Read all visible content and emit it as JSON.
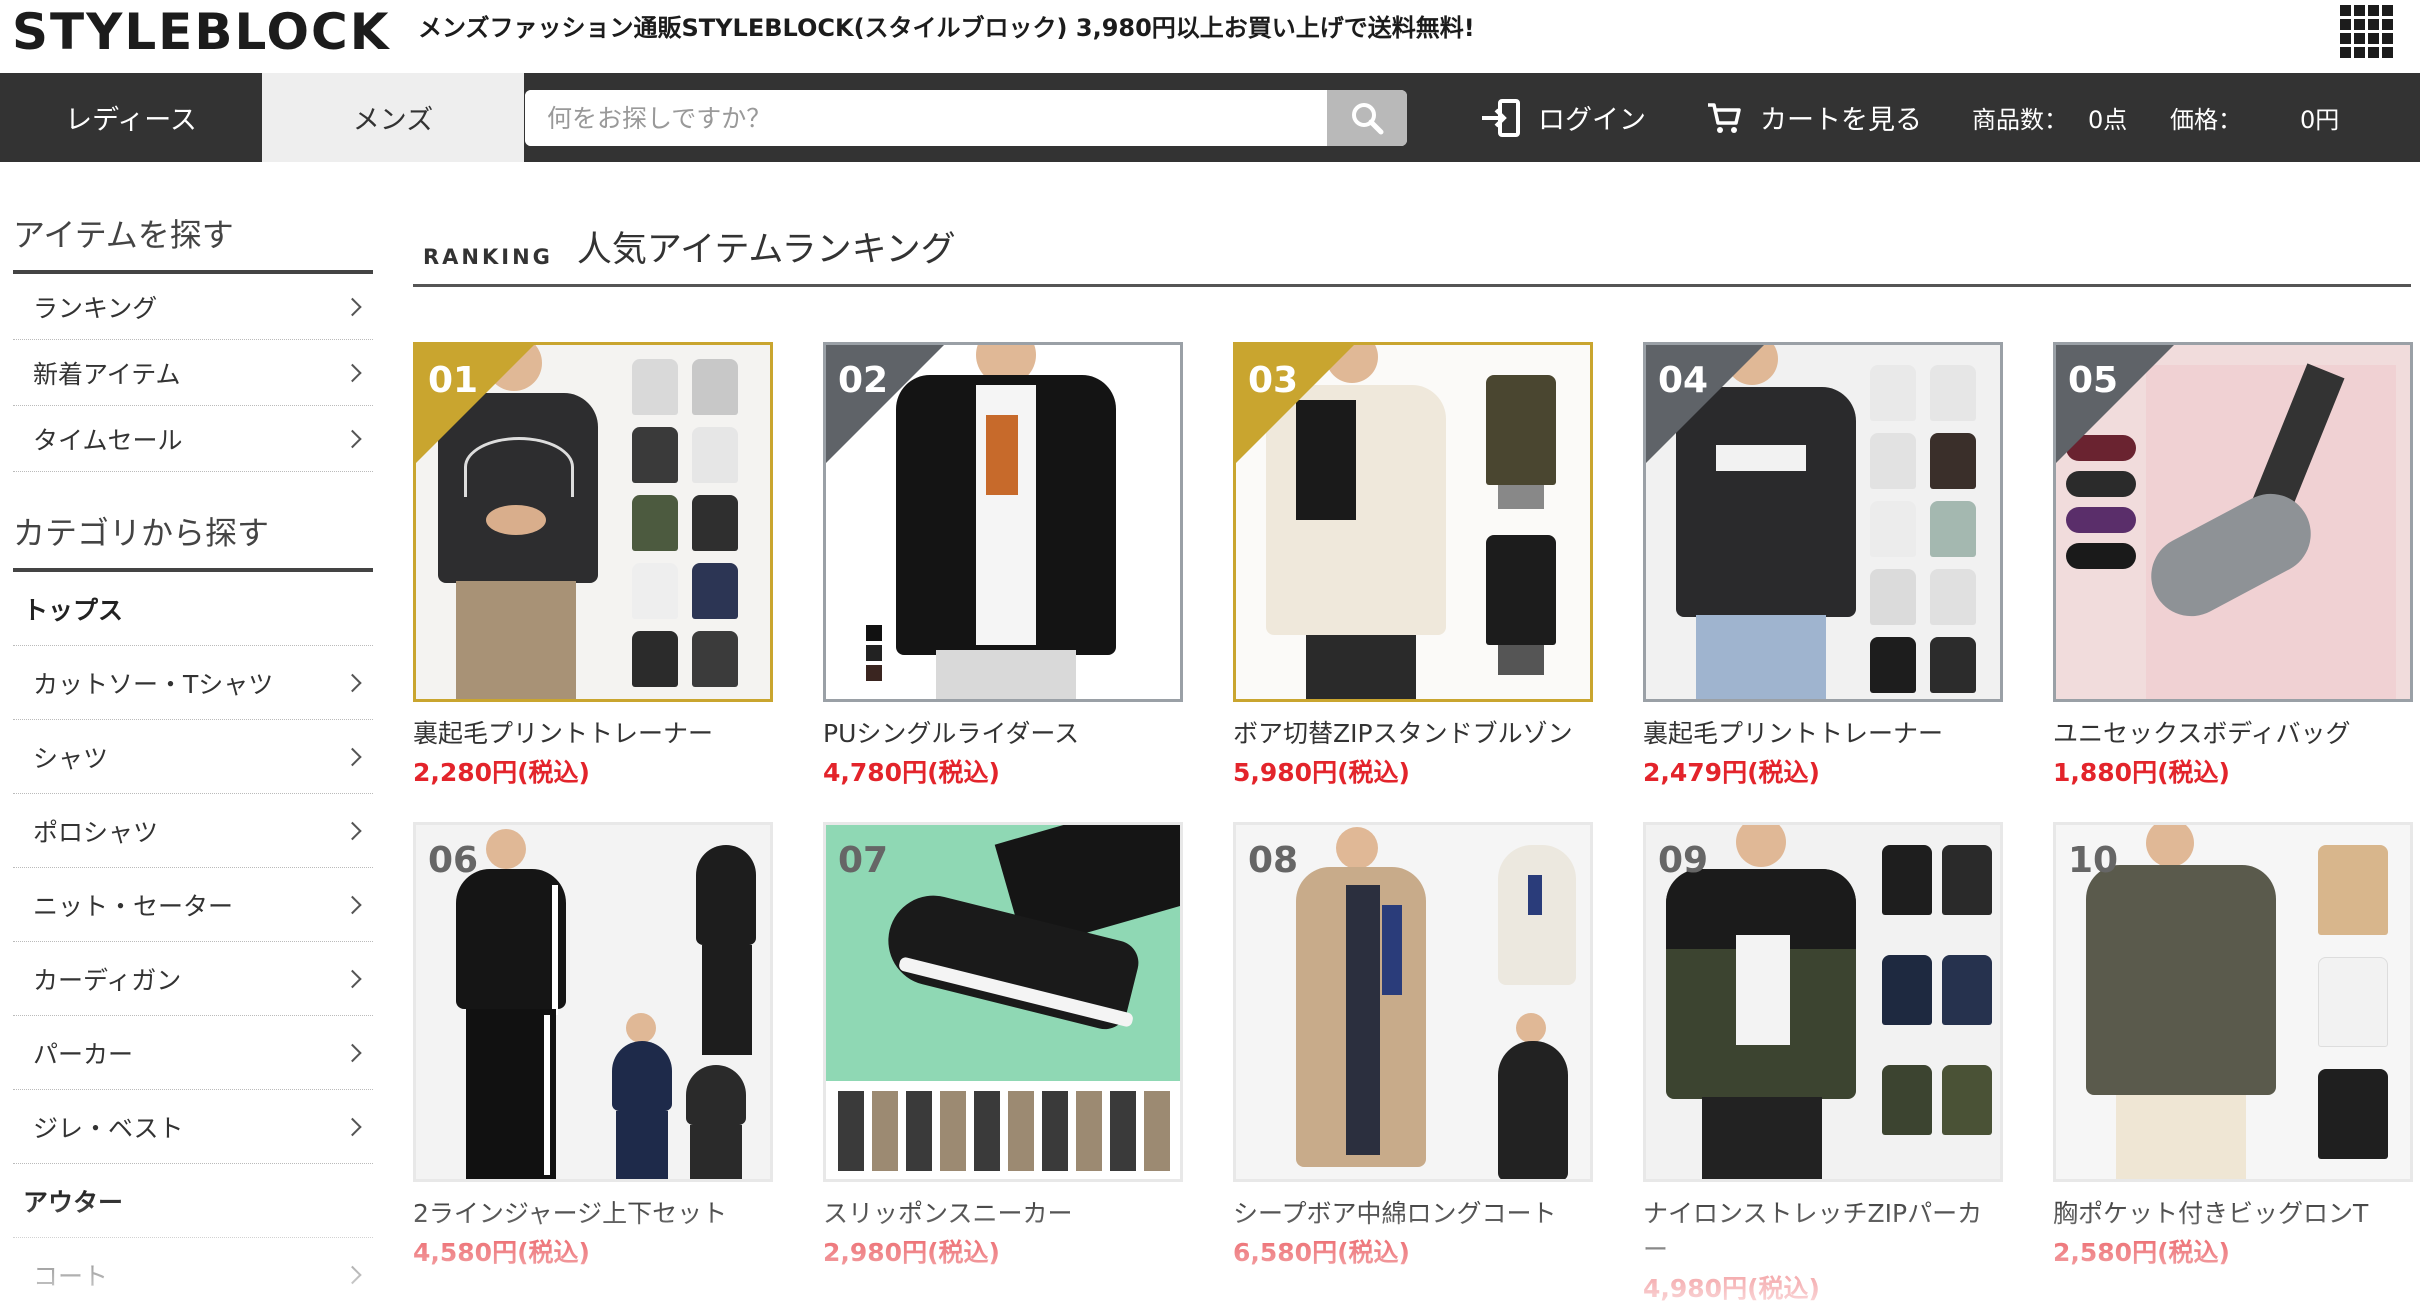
{
  "header": {
    "logo": "STYLEBLOCK",
    "tagline": "メンズファッション通販STYLEBLOCK(スタイルブロック) 3,980円以上お買い上げで送料無料!"
  },
  "nav": {
    "ladies": "レディース",
    "mens": "メンズ",
    "search_placeholder": "何をお探しですか？",
    "login": "ログイン",
    "cart": "カートを見る",
    "count_label": "商品数：",
    "count_value": "0点",
    "price_label": "価格：",
    "price_value": "0円"
  },
  "sidebar": {
    "items_heading": "アイテムを探す",
    "items": [
      "ランキング",
      "新着アイテム",
      "タイムセール"
    ],
    "category_heading": "カテゴリから探す",
    "group_tops": "トップス",
    "tops": [
      "カットソー・Tシャツ",
      "シャツ",
      "ポロシャツ",
      "ニット・セーター",
      "カーディガン",
      "パーカー",
      "ジレ・ベスト"
    ],
    "group_outer": "アウター",
    "outer": [
      "コート"
    ]
  },
  "ranking": {
    "label_en": "RANKING",
    "title": "人気アイテムランキング",
    "products": [
      {
        "rank": "01",
        "name": "裏起毛プリントトレーナー",
        "price": "2,280円(税込)"
      },
      {
        "rank": "02",
        "name": "PUシングルライダース",
        "price": "4,780円(税込)"
      },
      {
        "rank": "03",
        "name": "ボア切替ZIPスタンドブルゾン",
        "price": "5,980円(税込)"
      },
      {
        "rank": "04",
        "name": "裏起毛プリントトレーナー",
        "price": "2,479円(税込)"
      },
      {
        "rank": "05",
        "name": "ユニセックスボディバッグ",
        "price": "1,880円(税込)"
      },
      {
        "rank": "06",
        "name": "2ラインジャージ上下セット",
        "price": "4,580円(税込)"
      },
      {
        "rank": "07",
        "name": "スリッポンスニーカー",
        "price": "2,980円(税込)"
      },
      {
        "rank": "08",
        "name": "シープボア中綿ロングコート",
        "price": "6,580円(税込)"
      },
      {
        "rank": "09",
        "name": "ナイロンストレッチZIPパーカー",
        "price": "4,980円(税込)"
      },
      {
        "rank": "10",
        "name": "胸ポケット付きビッグロンT",
        "price": "2,580円(税込)"
      }
    ]
  },
  "colors": {
    "nav_bg": "#333333",
    "gold": "#c9a52f",
    "silver": "#5f6368",
    "price_red": "#e3242b"
  }
}
